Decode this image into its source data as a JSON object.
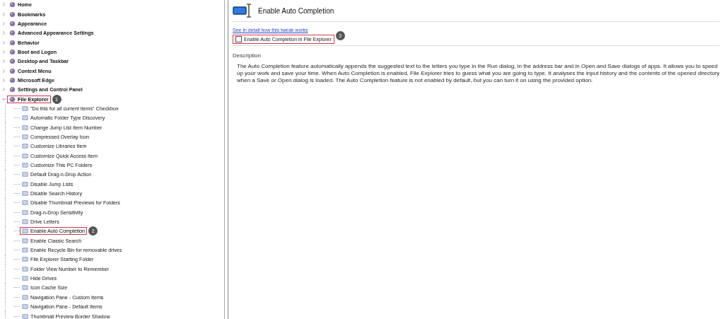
{
  "tree": [
    {
      "label": "Home",
      "expanded": false,
      "highlighted": false
    },
    {
      "label": "Bookmarks",
      "expanded": false,
      "highlighted": false
    },
    {
      "label": "Appearance",
      "expanded": false,
      "highlighted": false
    },
    {
      "label": "Advanced Appearance Settings",
      "expanded": false,
      "highlighted": false
    },
    {
      "label": "Behavior",
      "expanded": false,
      "highlighted": false
    },
    {
      "label": "Boot and Logon",
      "expanded": false,
      "highlighted": false
    },
    {
      "label": "Desktop and Taskbar",
      "expanded": false,
      "highlighted": false
    },
    {
      "label": "Context Menu",
      "expanded": false,
      "highlighted": false
    },
    {
      "label": "Microsoft Edge",
      "expanded": false,
      "highlighted": false
    },
    {
      "label": "Settings and Control Panel",
      "expanded": false,
      "highlighted": false
    },
    {
      "label": "File Explorer",
      "expanded": true,
      "highlighted": true,
      "callout": "1",
      "children": [
        {
          "label": "\"Do this for all current items\" Checkbox",
          "highlighted": false
        },
        {
          "label": "Automatic Folder Type Discovery",
          "highlighted": false
        },
        {
          "label": "Change Jump List Item Number",
          "highlighted": false
        },
        {
          "label": "Compressed Overlay Icon",
          "highlighted": false
        },
        {
          "label": "Customize Libraries Item",
          "highlighted": false
        },
        {
          "label": "Customize Quick Access Item",
          "highlighted": false
        },
        {
          "label": "Customize This PC Folders",
          "highlighted": false
        },
        {
          "label": "Default Drag-n-Drop Action",
          "highlighted": false
        },
        {
          "label": "Disable Jump Lists",
          "highlighted": false
        },
        {
          "label": "Disable Search History",
          "highlighted": false
        },
        {
          "label": "Disable Thumbnail Previews for Folders",
          "highlighted": false
        },
        {
          "label": "Drag-n-Drop Sensitivity",
          "highlighted": false
        },
        {
          "label": "Drive Letters",
          "highlighted": false
        },
        {
          "label": "Enable Auto Completion",
          "highlighted": true,
          "callout": "2"
        },
        {
          "label": "Enable Classic Search",
          "highlighted": false
        },
        {
          "label": "Enable Recycle Bin for removable drives",
          "highlighted": false
        },
        {
          "label": "File Explorer Starting Folder",
          "highlighted": false
        },
        {
          "label": "Folder View Number to Remember",
          "highlighted": false
        },
        {
          "label": "Hide Drives",
          "highlighted": false
        },
        {
          "label": "Icon Cache Size",
          "highlighted": false
        },
        {
          "label": "Navigation Pane - Custom Items",
          "highlighted": false
        },
        {
          "label": "Navigation Pane - Default Items",
          "highlighted": false
        },
        {
          "label": "Thumbnail Preview Border Shadow",
          "highlighted": false
        }
      ]
    }
  ],
  "detail": {
    "title": "Enable Auto Completion",
    "link": "See in detail how this tweak works",
    "option": {
      "label": "Enable Auto Completion in File Explorer",
      "checked": false,
      "highlighted": true,
      "callout": "3"
    },
    "description_heading": "Description",
    "description": "The Auto Completion feature automatically appends the suggested text to the letters you type in the Run dialog, in the address bar and in Open and Save dialogs of apps. It allows you to speed up your work and save your time. When Auto Completion is enabled, File Explorer tries to guess what you are going to type. It analyses the input history and the contents of the opened directory when a Save or Open dialog is loaded. The Auto Completion feature is not enabled by default, but you can turn it on using the provided option."
  }
}
